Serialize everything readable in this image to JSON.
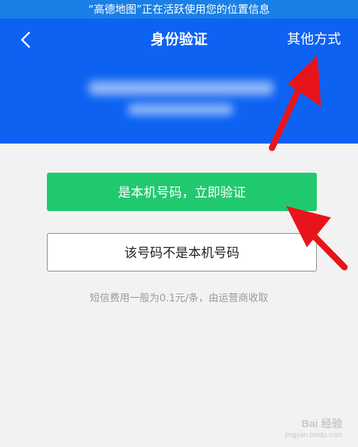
{
  "status_banner": {
    "text": "“高德地图”正在活跃使用您的位置信息"
  },
  "header": {
    "title": "身份验证",
    "other_methods_label": "其他方式",
    "back_icon": "chevron-left-icon"
  },
  "actions": {
    "confirm_label": "是本机号码，立即验证",
    "reject_label": "该号码不是本机号码"
  },
  "fee_note": "短信费用一般为0.1元/条，由运营商收取",
  "watermark": {
    "brand": "Bai 经验",
    "url": "jingyan.baidu.com"
  },
  "colors": {
    "status_bar": "#1a7fe6",
    "header_bg": "#0d62f2",
    "primary_button": "#21c96e",
    "annotation_arrow": "#e8141b"
  }
}
